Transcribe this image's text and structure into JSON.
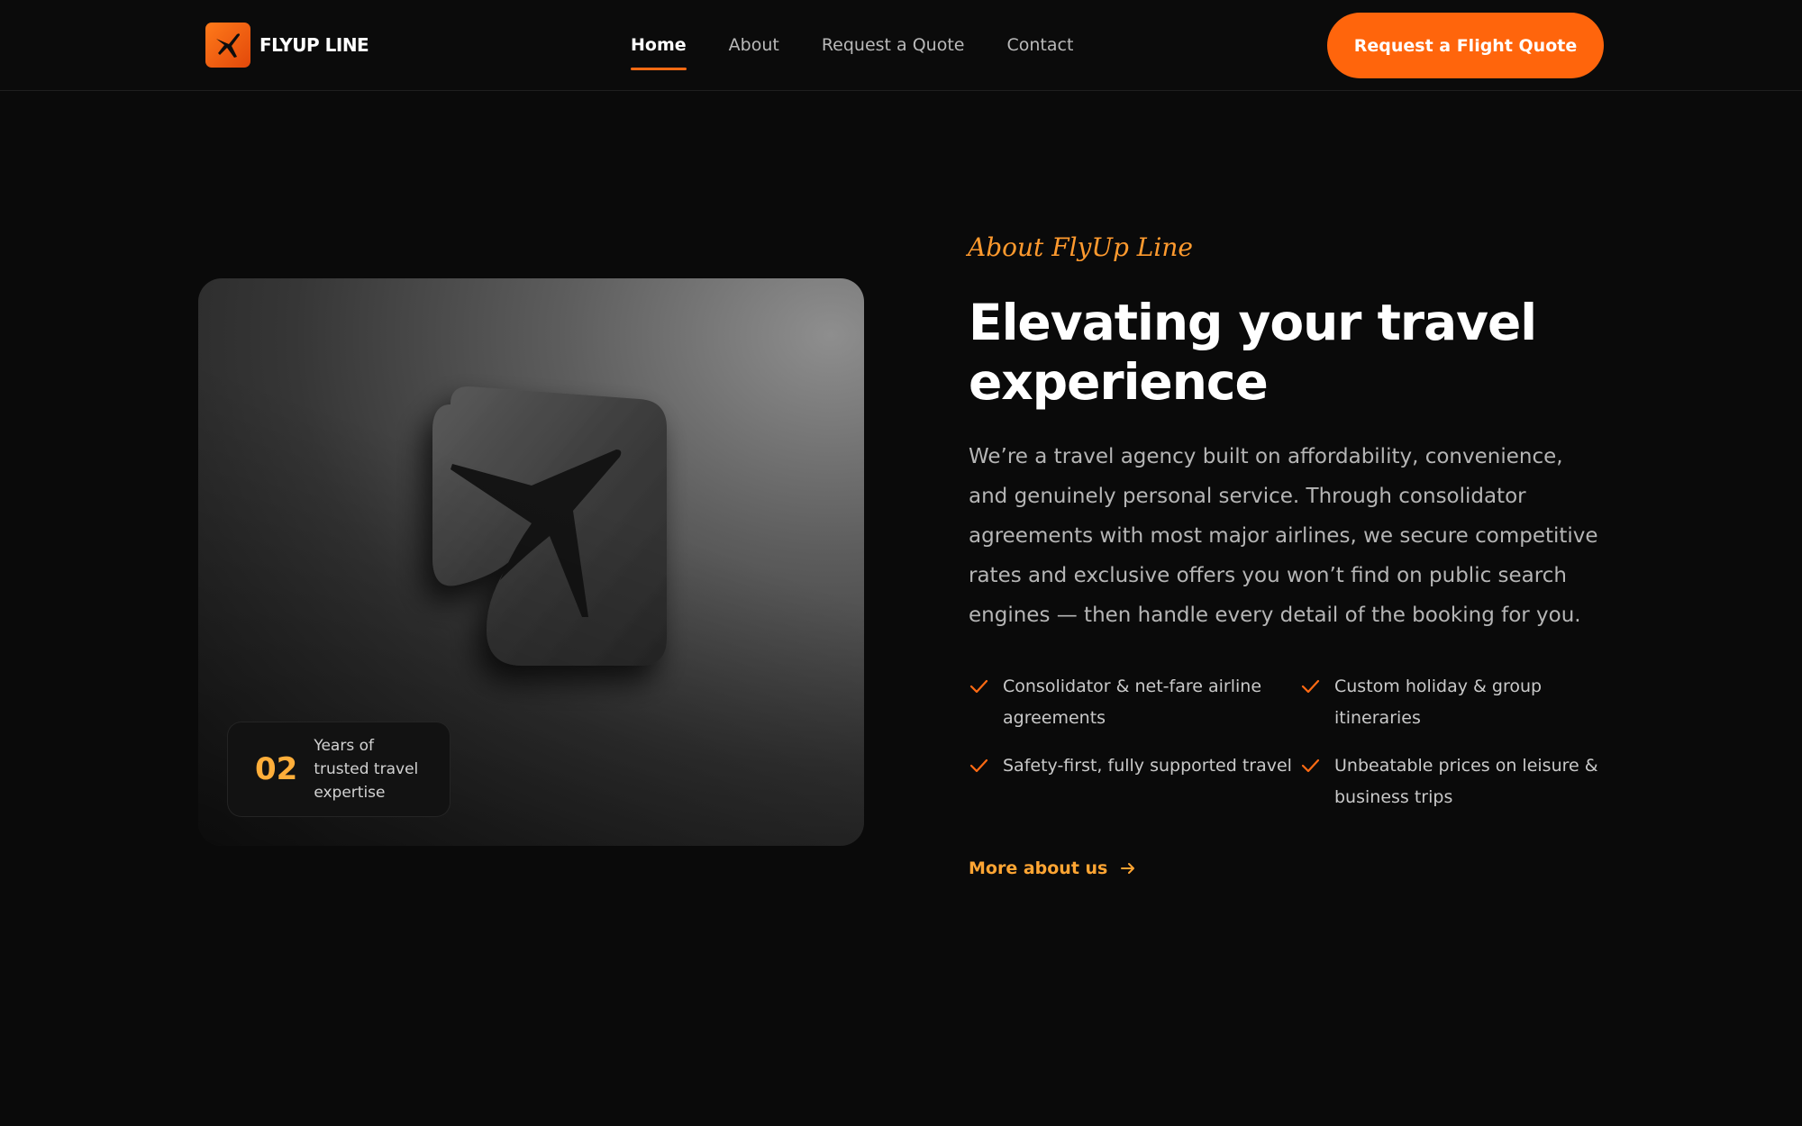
{
  "colors": {
    "accent": "#ff650c",
    "accent_light": "#ffa533",
    "background": "#0a0a0a",
    "text_muted": "#b5b5b5"
  },
  "header": {
    "logo_text": "FLYUP LINE",
    "logo_icon": "plane-icon",
    "nav": [
      {
        "label": "Home",
        "active": true
      },
      {
        "label": "About",
        "active": false
      },
      {
        "label": "Request a Quote",
        "active": false
      },
      {
        "label": "Contact",
        "active": false
      }
    ],
    "cta_label": "Request a Flight Quote"
  },
  "media": {
    "image_icon": "plane-logo-tile-icon",
    "stat": {
      "number": "02",
      "label": "Years of trusted travel expertise"
    }
  },
  "about": {
    "eyebrow": "About FlyUp Line",
    "headline": "Elevating your travel experience",
    "body": "We’re a travel agency built on affordability, convenience, and genuinely personal service. Through consolidator agreements with most major airlines, we secure competitive rates and exclusive offers you won’t find on public search engines — then handle every detail of the booking for you.",
    "features": [
      "Consolidator & net-fare airline agreements",
      "Custom holiday & group itineraries",
      "Safety-first, fully supported travel",
      "Unbeatable prices on leisure & business trips"
    ],
    "check_icon": "checkmark-icon",
    "more_link": "More about us",
    "more_icon": "arrow-right-icon"
  }
}
